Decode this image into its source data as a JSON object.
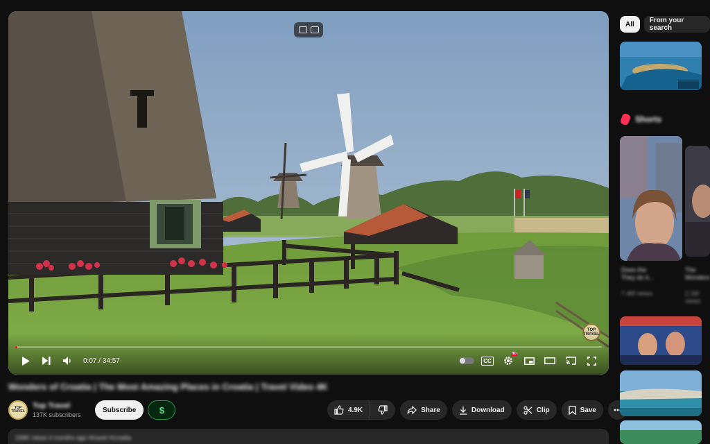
{
  "player": {
    "time_display": "0:07 / 34:57",
    "progress_fraction": 0.0033,
    "watermark_text": "TOP TRAVEL",
    "controls": {
      "play_icon": "play-icon",
      "next_icon": "next-icon",
      "volume_icon": "volume-icon",
      "cc_label": "CC",
      "hd_badge": "HD"
    }
  },
  "video": {
    "title": "Wonders of Croatia | The Most Amazing Places in Croatia | Travel Video 4K"
  },
  "channel": {
    "name": "Top Travel",
    "subscribers": "137K subscribers",
    "avatar_text": "TOP TRAVEL",
    "subscribe_label": "Subscribe",
    "thanks_label": "$"
  },
  "actions": {
    "like_count": "4.9K",
    "share_label": "Share",
    "download_label": "Download",
    "clip_label": "Clip",
    "save_label": "Save"
  },
  "description": {
    "meta": "248K views  4 months ago  #travel #croatia"
  },
  "sidebar": {
    "chips": [
      {
        "label": "All",
        "active": true
      },
      {
        "label": "From your search",
        "active": false
      }
    ],
    "shorts_label": "Shorts",
    "shorts": [
      {
        "title": "Does the\nThey do it..."
      },
      {
        "title": "The\nWonders"
      }
    ],
    "short_views": [
      "7.4M views",
      "2.1M views"
    ]
  },
  "colors": {
    "background": "#0f0f0f",
    "progress": "#ff0033",
    "pill": "#272727",
    "thanks_green": "#1f9c4a"
  }
}
